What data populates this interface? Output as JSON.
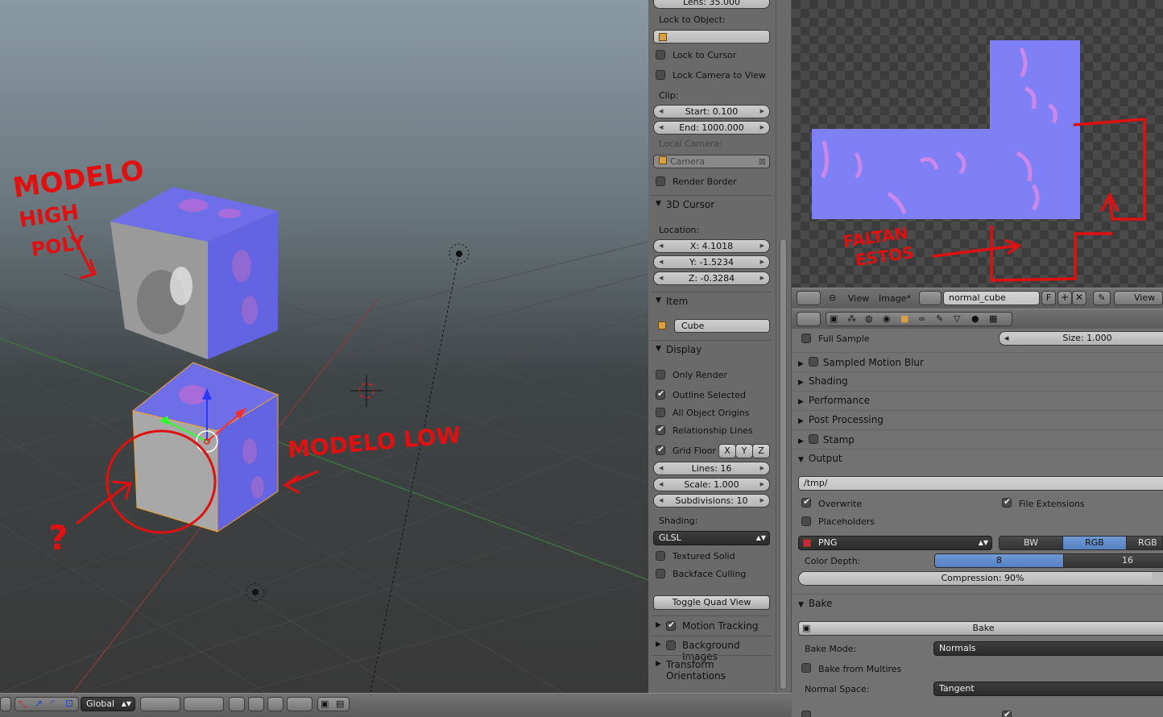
{
  "viewport": {
    "annotations": {
      "high_line1": "MODELO",
      "high_line2": "HIGH",
      "high_line3": "POLY",
      "low": "MODELO LOW",
      "question": "?",
      "faltan_line1": "FALTAN",
      "faltan_line2": "ESTOS"
    },
    "header": {
      "orientation_value": "Global"
    }
  },
  "npanel": {
    "lens": "Lens: 35.000",
    "lock_to_object_label": "Lock to Object:",
    "lock_to_cursor": "Lock to Cursor",
    "lock_camera_to_view": "Lock Camera to View",
    "clip_label": "Clip:",
    "clip_start": "Start: 0.100",
    "clip_end": "End: 1000.000",
    "local_camera_label": "Local Camera:",
    "local_camera_value": "Camera",
    "render_border": "Render Border",
    "cursor_header": "3D Cursor",
    "location_label": "Location:",
    "loc_x": "X: 4.1018",
    "loc_y": "Y: -1.5234",
    "loc_z": "Z: -0.3284",
    "item_header": "Item",
    "item_name": "Cube",
    "display_header": "Display",
    "only_render": "Only Render",
    "outline_selected": "Outline Selected",
    "all_object_origins": "All Object Origins",
    "relationship_lines": "Relationship Lines",
    "grid_floor": "Grid Floor",
    "axis_x": "X",
    "axis_y": "Y",
    "axis_z": "Z",
    "lines": "Lines: 16",
    "scale": "Scale: 1.000",
    "subdivisions": "Subdivisions: 10",
    "shading_label": "Shading:",
    "shading_value": "GLSL",
    "textured_solid": "Textured Solid",
    "backface_culling": "Backface Culling",
    "toggle_quad_view": "Toggle Quad View",
    "motion_tracking": "Motion Tracking",
    "background_images": "Background Images",
    "transform_orientations": "Transform Orientations"
  },
  "image_editor": {
    "menu_view": "View",
    "menu_image": "Image*",
    "image_name": "normal_cube",
    "fake_user": "F",
    "view_btn": "View"
  },
  "properties": {
    "full_sample": "Full Sample",
    "size": "Size: 1.000",
    "sampled_motion_blur": "Sampled Motion Blur",
    "shading": "Shading",
    "performance": "Performance",
    "post_processing": "Post Processing",
    "stamp": "Stamp",
    "output": "Output",
    "output_path": "/tmp/",
    "overwrite": "Overwrite",
    "file_extensions": "File Extensions",
    "placeholders": "Placeholders",
    "format": "PNG",
    "bw": "BW",
    "rgb": "RGB",
    "rgba": "RGB",
    "color_depth_label": "Color Depth:",
    "depth_8": "8",
    "depth_16": "16",
    "compression": "Compression: 90%",
    "compression_value": 0.9,
    "bake_header": "Bake",
    "bake_button": "Bake",
    "bake_mode_label": "Bake Mode:",
    "bake_mode_value": "Normals",
    "bake_from_multires": "Bake from Multires",
    "normal_space_label": "Normal Space:",
    "normal_space_value": "Tangent"
  },
  "colors": {
    "accent_blue": "#5680c2",
    "annotation_red": "#e01010",
    "normal_map_base": "#7f7ff6"
  }
}
